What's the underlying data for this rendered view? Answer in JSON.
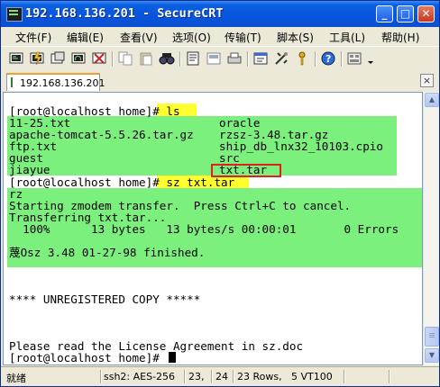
{
  "window": {
    "title": "192.168.136.201 - SecureCRT"
  },
  "title_buttons": {
    "minimize": "_",
    "maximize": "□",
    "close": "✕"
  },
  "menu": [
    "文件(F)",
    "编辑(E)",
    "查看(V)",
    "选项(O)",
    "传输(T)",
    "脚本(S)",
    "工具(L)",
    "帮助(H)"
  ],
  "toolbar_icons": [
    "connect-icon",
    "quick-connect-icon",
    "connect-tab-icon",
    "reconnect-icon",
    "disconnect-icon",
    "copy-icon",
    "paste-icon",
    "copy-paste-icon",
    "find-icon",
    "print-icon",
    "print-selection-icon",
    "printer-icon",
    "session-options-icon",
    "global-options-icon",
    "key-icon",
    "help-icon",
    "keymap-icon"
  ],
  "tab": {
    "label": "192.168.136.201",
    "close": "×"
  },
  "terminal": {
    "prompt_ls": "[root@localhost home]# ls",
    "ls_col1": [
      "11-25.txt",
      "apache-tomcat-5.5.26.tar.gz",
      "ftp.txt",
      "guest",
      "jiayue"
    ],
    "ls_col2": [
      "oracle",
      "rzsz-3.48.tar.gz",
      "ship_db_lnx32_10103.cpio",
      "src",
      "txt.tar"
    ],
    "prompt_sz": "[root@localhost home]# sz txt.tar",
    "transfer_lines": [
      "rz",
      "Starting zmodem transfer.  Press Ctrl+C to cancel.",
      "Transferring txt.tar...",
      "  100%      13 bytes   13 bytes/s 00:00:01       0 Errors",
      "",
      "蔑Osz 3.48 01-27-98 finished."
    ],
    "unregistered": "**** UNREGISTERED COPY *****",
    "license": "Please read the License Agreement in sz.doc",
    "final_prompt": "[root@localhost home]# "
  },
  "status": {
    "ready": "就绪",
    "cipher": "ssh2: AES-256",
    "row": "23,",
    "col": "24",
    "rows": "23 Rows,",
    "cols": "5 VT100"
  },
  "colors": {
    "highlight_green": "#7cf07c",
    "highlight_yellow": "#ffff30",
    "box_red": "#e0201a",
    "title_blue": "#0855dd"
  }
}
